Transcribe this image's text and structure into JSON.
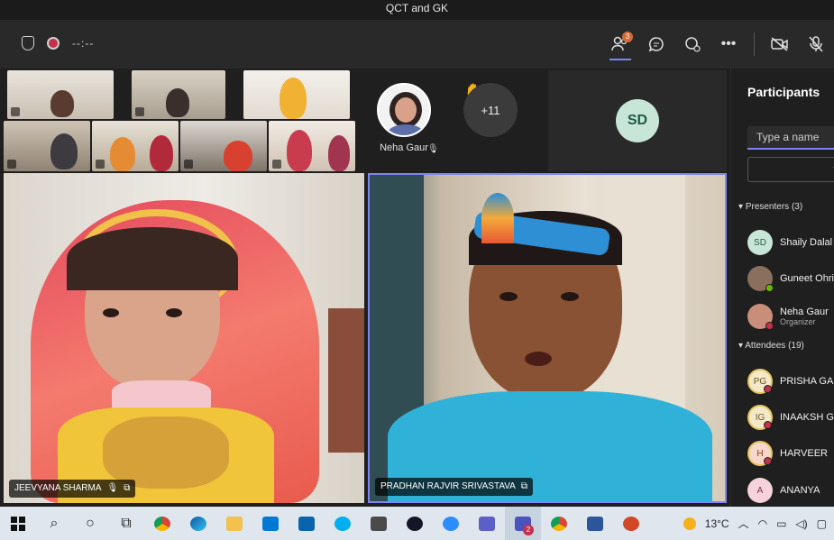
{
  "window": {
    "title": "QCT and GK"
  },
  "toolbar": {
    "timer": "--:--",
    "participants_badge": "3"
  },
  "tiles": {
    "noha_name": "Neha Gaur",
    "overflow_label": "+11",
    "sd_initials": "SD"
  },
  "videos": {
    "left_name": "JEEVYANA SHARMA",
    "right_name": "PRADHAN RAJVIR SRIVASTAVA"
  },
  "panel": {
    "title": "Participants",
    "search_placeholder": "Type a name",
    "presenters_label": "Presenters (3)",
    "attendees_label": "Attendees (19)",
    "presenters": [
      {
        "initials": "SD",
        "name": "Shaily Dalal",
        "role": "",
        "color": "#c8e6d8"
      },
      {
        "initials": "",
        "name": "Guneet Ohri",
        "role": "",
        "color": "#8a6f5c"
      },
      {
        "initials": "",
        "name": "Neha Gaur",
        "role": "Organizer",
        "color": "#c98e7a"
      }
    ],
    "attendees": [
      {
        "initials": "PG",
        "name": "PRISHA GAR"
      },
      {
        "initials": "IG",
        "name": "INAAKSH GO"
      },
      {
        "initials": "H",
        "name": "HARVEER"
      },
      {
        "initials": "A",
        "name": "ANANYA"
      }
    ]
  },
  "taskbar": {
    "weather": "13°C",
    "teams_badge": "2"
  },
  "colors": {
    "accent": "#7f85f5",
    "mute_red": "#c4314b"
  }
}
